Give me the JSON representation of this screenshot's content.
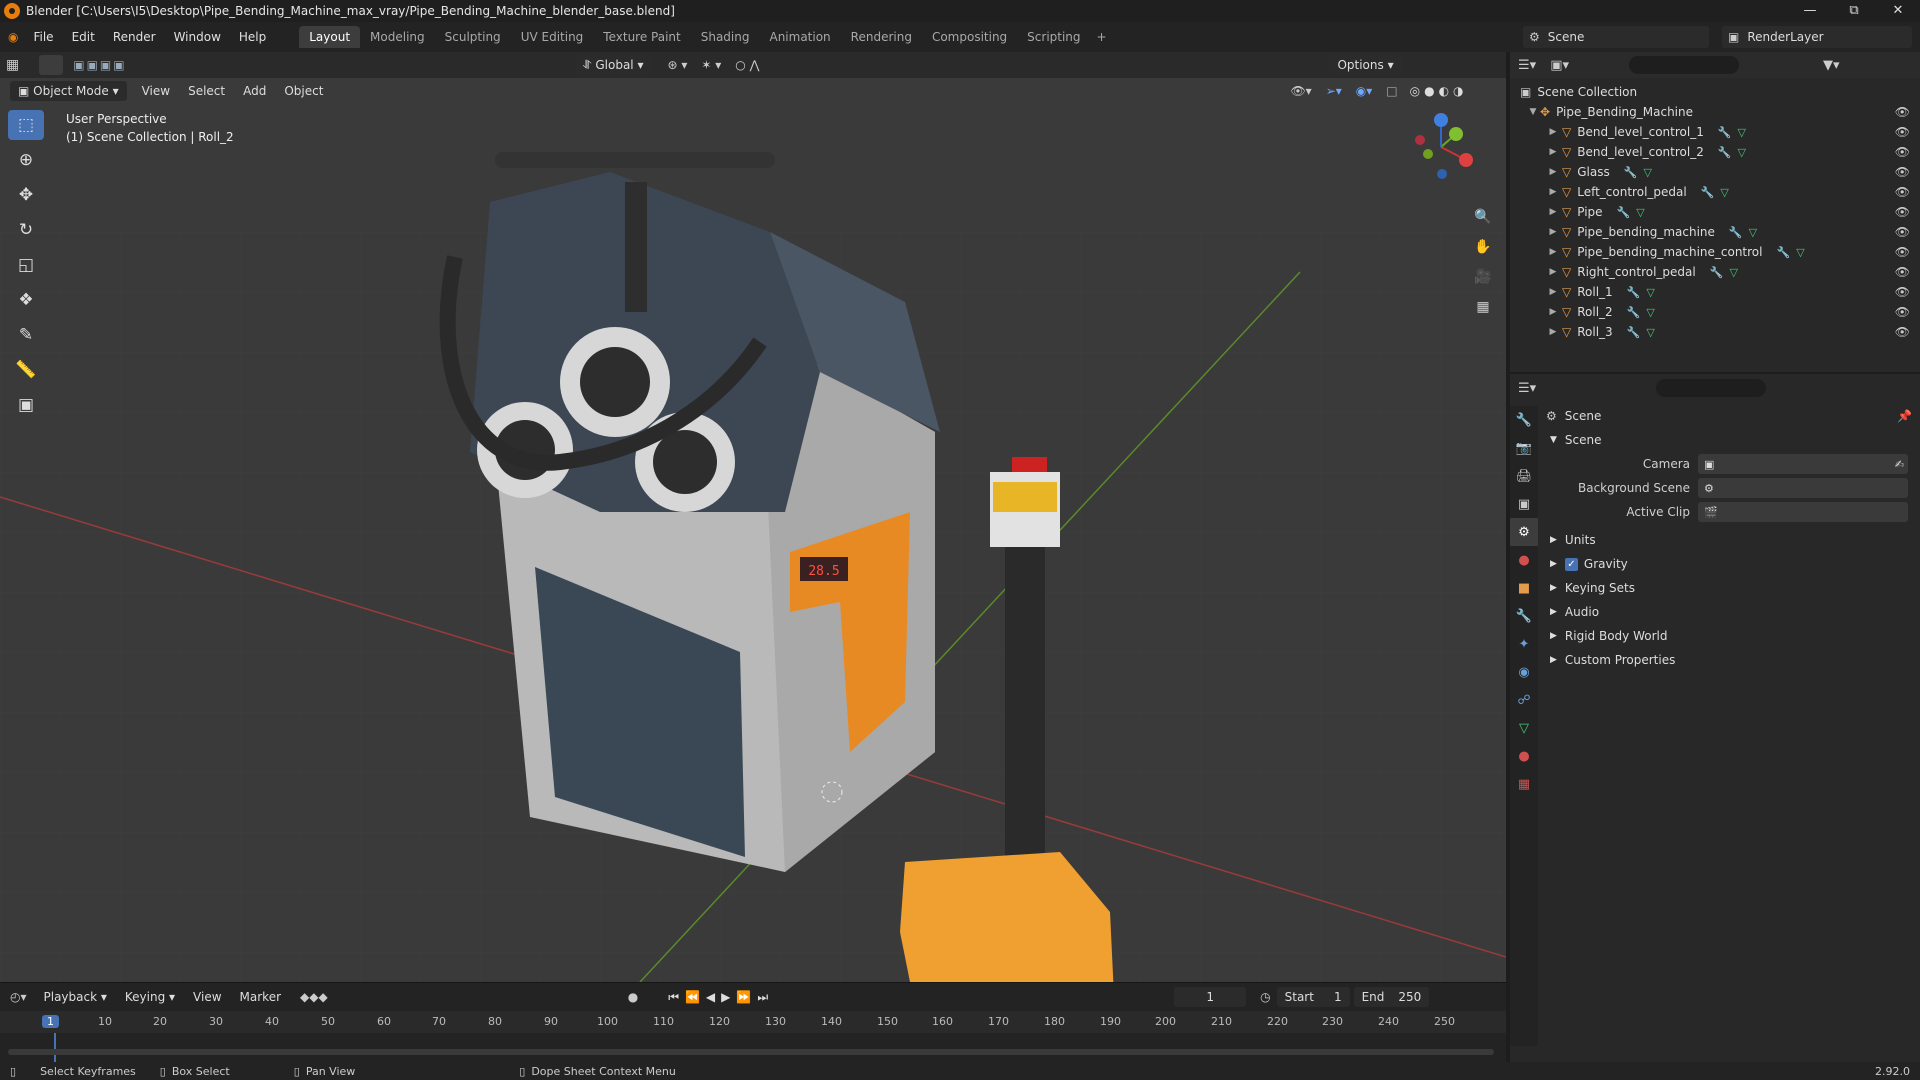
{
  "title": "Blender [C:\\Users\\I5\\Desktop\\Pipe_Bending_Machine_max_vray/Pipe_Bending_Machine_blender_base.blend]",
  "menu": [
    "File",
    "Edit",
    "Render",
    "Window",
    "Help"
  ],
  "workspaces": [
    "Layout",
    "Modeling",
    "Sculpting",
    "UV Editing",
    "Texture Paint",
    "Shading",
    "Animation",
    "Rendering",
    "Compositing",
    "Scripting"
  ],
  "scene": "Scene",
  "render_layer": "RenderLayer",
  "viewport": {
    "mode": "Object Mode",
    "menus": [
      "View",
      "Select",
      "Add",
      "Object"
    ],
    "transform": "Global",
    "options": "Options",
    "info_line1": "User Perspective",
    "info_line2": "(1) Scene Collection | Roll_2",
    "display_value": "28.5"
  },
  "outliner": {
    "root": "Scene Collection",
    "collection": "Pipe_Bending_Machine",
    "items": [
      "Bend_level_control_1",
      "Bend_level_control_2",
      "Glass",
      "Left_control_pedal",
      "Pipe",
      "Pipe_bending_machine",
      "Pipe_bending_machine_control",
      "Right_control_pedal",
      "Roll_1",
      "Roll_2",
      "Roll_3"
    ]
  },
  "properties": {
    "header": "Scene",
    "section": "Scene",
    "fields": [
      {
        "label": "Camera",
        "value": ""
      },
      {
        "label": "Background Scene",
        "value": ""
      },
      {
        "label": "Active Clip",
        "value": ""
      }
    ],
    "subsections": [
      "Units",
      "Gravity",
      "Keying Sets",
      "Audio",
      "Rigid Body World",
      "Custom Properties"
    ],
    "gravity_checked": true
  },
  "timeline": {
    "menus": [
      "Playback",
      "Keying",
      "View",
      "Marker"
    ],
    "current_frame": "1",
    "start_label": "Start",
    "start": "1",
    "end_label": "End",
    "end": "250",
    "ticks": [
      "1",
      "10",
      "20",
      "30",
      "40",
      "50",
      "60",
      "70",
      "80",
      "90",
      "100",
      "110",
      "120",
      "130",
      "140",
      "150",
      "160",
      "170",
      "180",
      "190",
      "200",
      "210",
      "220",
      "230",
      "240",
      "250"
    ]
  },
  "status": {
    "items": [
      "Select Keyframes",
      "Box Select",
      "Pan View",
      "Dope Sheet Context Menu"
    ],
    "version": "2.92.0"
  }
}
